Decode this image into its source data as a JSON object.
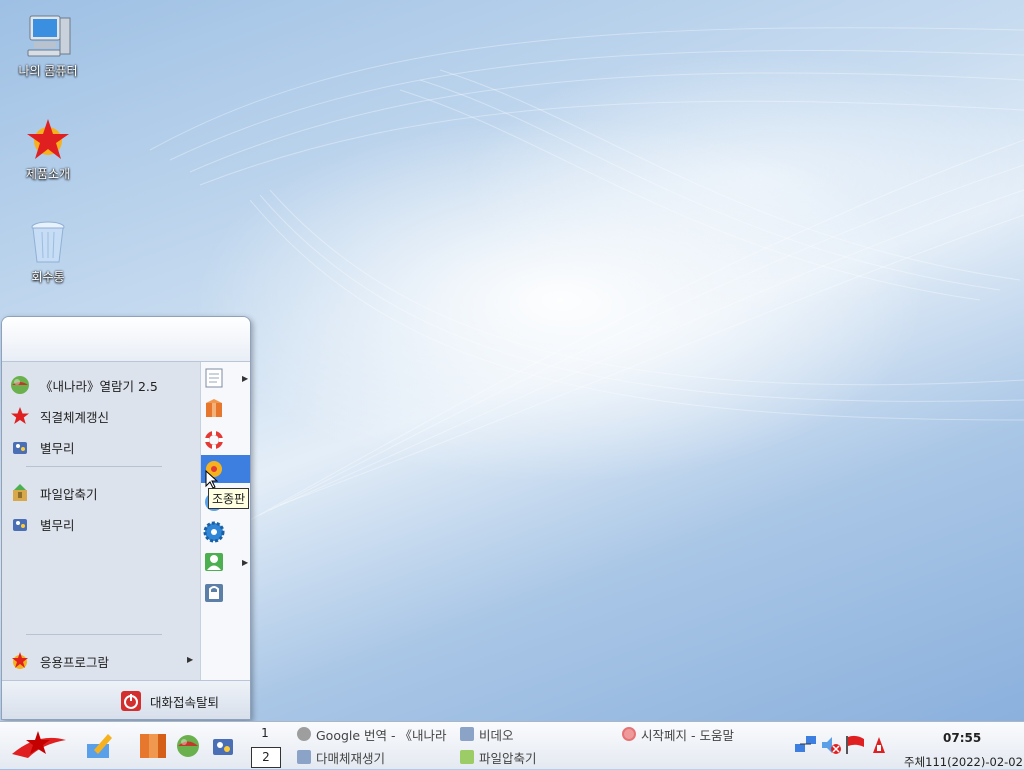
{
  "desktop": {
    "icons": [
      {
        "label": "나의 콤퓨터",
        "icon": "computer-icon"
      },
      {
        "label": "제품소개",
        "icon": "red-star-icon"
      },
      {
        "label": "회수통",
        "icon": "trash-icon"
      }
    ]
  },
  "start_menu": {
    "items": [
      {
        "label": "《내나라》열람기 2.5",
        "icon": "browser-globe-icon"
      },
      {
        "label": "직결체계갱신",
        "icon": "update-star-icon"
      },
      {
        "label": "별무리",
        "icon": "byolmuri-icon"
      },
      {
        "label": "파일압축기",
        "icon": "archive-icon"
      },
      {
        "label": "별무리",
        "icon": "byolmuri-icon"
      },
      {
        "label": "응용프로그람",
        "icon": "applications-icon"
      }
    ],
    "logout_label": "대화접속탈퇴",
    "right_icons": [
      "documents-icon",
      "packages-icon",
      "help-lifebuoy-icon",
      "control-panel-icon",
      "settings-icon",
      "gear-icon",
      "user-icon",
      "lock-icon"
    ],
    "tooltip": "조종판"
  },
  "taskbar": {
    "workspaces": [
      "1",
      "2"
    ],
    "tasks": [
      {
        "label": "Google 번역 - 《내나라",
        "icon": "browser-globe-icon"
      },
      {
        "label": "비데오",
        "icon": "video-icon"
      },
      {
        "label": "시작페지 - 도움말",
        "icon": "help-lifebuoy-icon"
      },
      {
        "label": "다매체재생기",
        "icon": "media-player-icon"
      },
      {
        "label": "파일압축기",
        "icon": "archive-icon"
      }
    ],
    "time": "07:55",
    "date": "주체111(2022)-02-02"
  }
}
